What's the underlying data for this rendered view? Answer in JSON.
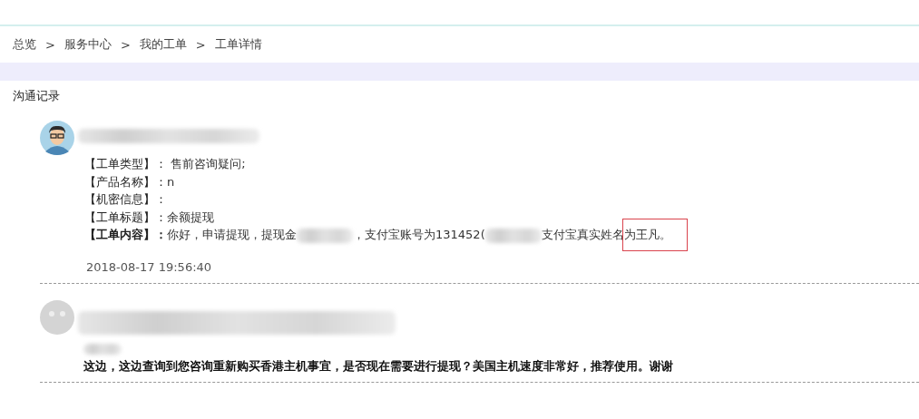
{
  "breadcrumb": [
    {
      "label": "总览"
    },
    {
      "label": "服务中心"
    },
    {
      "label": "我的工单"
    },
    {
      "label": "工单详情"
    }
  ],
  "breadcrumb_separator": ">",
  "section_title": "沟通记录",
  "messages": [
    {
      "kind": "customer",
      "fields": [
        {
          "label": "【工单类型】：",
          "bold": false,
          "segments": [
            {
              "kind": "text",
              "text": " 售前咨询疑问;"
            }
          ]
        },
        {
          "label": "【产品名称】：",
          "bold": false,
          "segments": [
            {
              "kind": "text",
              "text": "n"
            }
          ]
        },
        {
          "label": "【机密信息】：",
          "bold": false
        },
        {
          "label": "【工单标题】：",
          "bold": false,
          "segments": [
            {
              "kind": "text",
              "text": "余额提现"
            }
          ]
        },
        {
          "label": "【工单内容】：",
          "bold": true,
          "segments": [
            {
              "kind": "text",
              "text": "你好，申请提现，提现金"
            },
            {
              "kind": "redacted"
            },
            {
              "kind": "text",
              "text": "，支付宝账号为131452("
            },
            {
              "kind": "redacted"
            },
            {
              "kind": "text",
              "text": "支付宝真实姓名"
            },
            {
              "kind": "highlighted",
              "text": "为王凡。"
            }
          ]
        }
      ],
      "time": "2018-08-17 19:56:40"
    },
    {
      "kind": "staff",
      "body": "这边，这边查询到您咨询重新购买香港主机事宜，是否现在需要进行提现？美国主机速度非常好，推荐使用。谢谢"
    }
  ]
}
